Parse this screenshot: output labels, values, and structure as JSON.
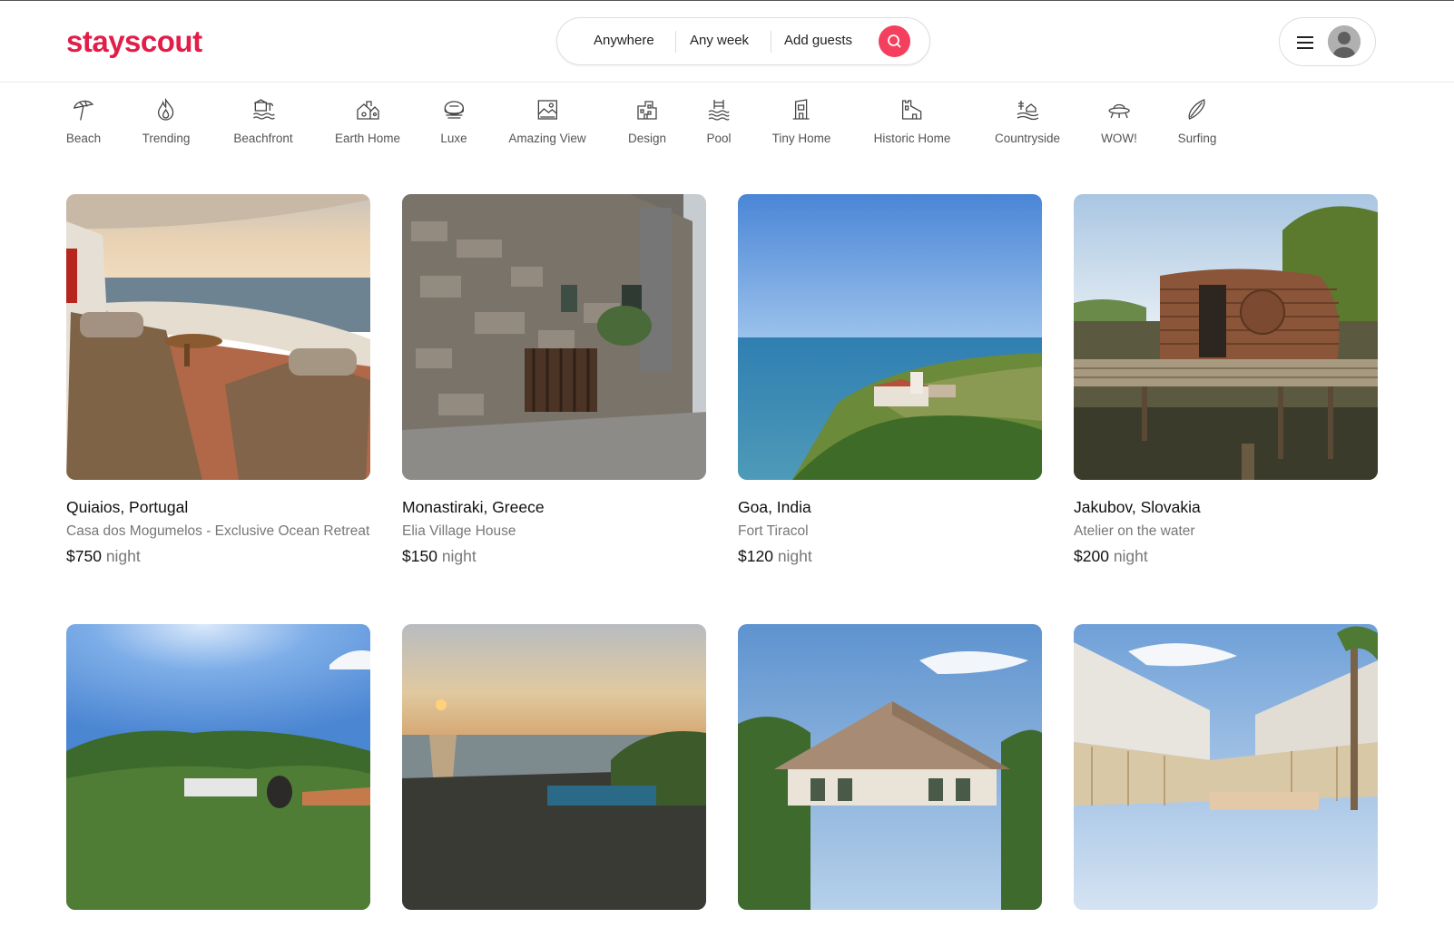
{
  "header": {
    "logo": "stayscout",
    "search": {
      "location": "Anywhere",
      "dates": "Any week",
      "guests": "Add guests",
      "search_icon": "search-icon"
    },
    "user_menu": {
      "menu_icon": "hamburger-menu-icon",
      "avatar_icon": "user-avatar-icon"
    }
  },
  "categories": [
    {
      "label": "Beach",
      "icon": "beach-umbrella-icon"
    },
    {
      "label": "Trending",
      "icon": "flame-icon"
    },
    {
      "label": "Beachfront",
      "icon": "beachfront-icon"
    },
    {
      "label": "Earth Home",
      "icon": "earth-home-icon"
    },
    {
      "label": "Luxe",
      "icon": "diamond-icon"
    },
    {
      "label": "Amazing View",
      "icon": "view-picture-icon"
    },
    {
      "label": "Design",
      "icon": "design-building-icon"
    },
    {
      "label": "Pool",
      "icon": "pool-icon"
    },
    {
      "label": "Tiny Home",
      "icon": "tiny-home-icon"
    },
    {
      "label": "Historic Home",
      "icon": "historic-home-icon"
    },
    {
      "label": "Countryside",
      "icon": "countryside-icon"
    },
    {
      "label": "WOW!",
      "icon": "ufo-icon"
    },
    {
      "label": "Surfing",
      "icon": "surfboard-icon"
    }
  ],
  "listings": [
    {
      "location": "Quiaios, Portugal",
      "title": "Casa dos Mogumelos - Exclusive Ocean Retreat",
      "price": "$750",
      "unit": "night"
    },
    {
      "location": "Monastiraki, Greece",
      "title": "Elia Village House",
      "price": "$150",
      "unit": "night"
    },
    {
      "location": "Goa, India",
      "title": "Fort Tiracol",
      "price": "$120",
      "unit": "night"
    },
    {
      "location": "Jakubov, Slovakia",
      "title": "Atelier on the water",
      "price": "$200",
      "unit": "night"
    },
    {
      "location": "",
      "title": "",
      "price": "",
      "unit": ""
    },
    {
      "location": "",
      "title": "",
      "price": "",
      "unit": ""
    },
    {
      "location": "",
      "title": "",
      "price": "",
      "unit": ""
    },
    {
      "location": "",
      "title": "",
      "price": "",
      "unit": ""
    }
  ],
  "colors": {
    "brand": "#e11d48",
    "search_button": "#f43f5e",
    "muted_text": "#777777"
  }
}
